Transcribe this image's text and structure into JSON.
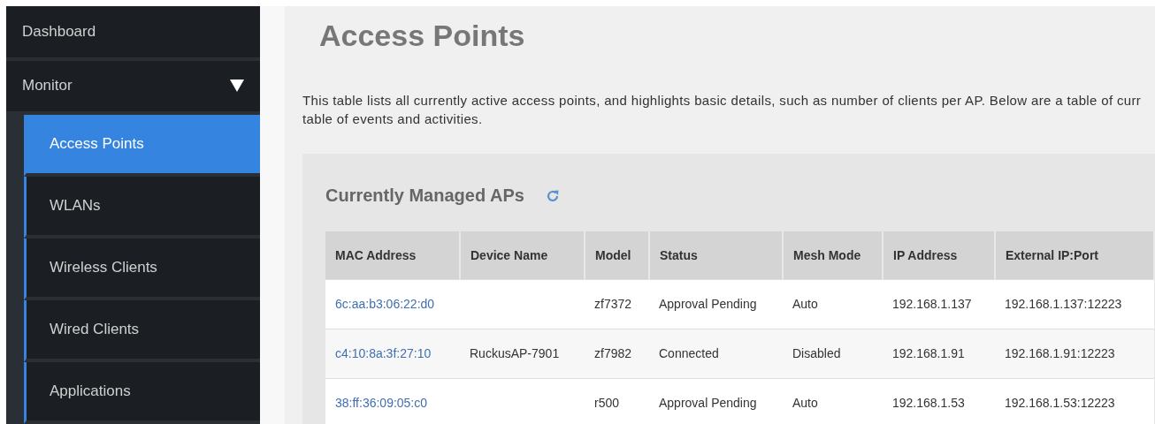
{
  "sidebar": {
    "items": [
      {
        "label": "Dashboard",
        "selected": false
      },
      {
        "label": "Monitor",
        "expanded": true,
        "selected": false,
        "children": [
          {
            "label": "Access Points",
            "selected": true
          },
          {
            "label": "WLANs",
            "selected": false
          },
          {
            "label": "Wireless Clients",
            "selected": false
          },
          {
            "label": "Wired Clients",
            "selected": false
          },
          {
            "label": "Applications",
            "selected": false
          }
        ]
      }
    ]
  },
  "page": {
    "title": "Access Points",
    "description": [
      "This table lists all currently active access points, and highlights basic details, such as number of clients per AP. Below are a table of curr",
      "table of events and activities."
    ]
  },
  "panel": {
    "title": "Currently Managed APs",
    "table": {
      "columns": [
        "MAC Address",
        "Device Name",
        "Model",
        "Status",
        "Mesh Mode",
        "IP Address",
        "External IP:Port"
      ],
      "rows": [
        [
          "6c:aa:b3:06:22:d0",
          "",
          "zf7372",
          "Approval Pending",
          "Auto",
          "192.168.1.137",
          "192.168.1.137:12223"
        ],
        [
          "c4:10:8a:3f:27:10",
          "RuckusAP-7901",
          "zf7982",
          "Connected",
          "Disabled",
          "192.168.1.91",
          "192.168.1.91:12223"
        ],
        [
          "38:ff:36:09:05:c0",
          "",
          "r500",
          "Approval Pending",
          "Auto",
          "192.168.1.53",
          "192.168.1.53:12223"
        ]
      ]
    }
  }
}
